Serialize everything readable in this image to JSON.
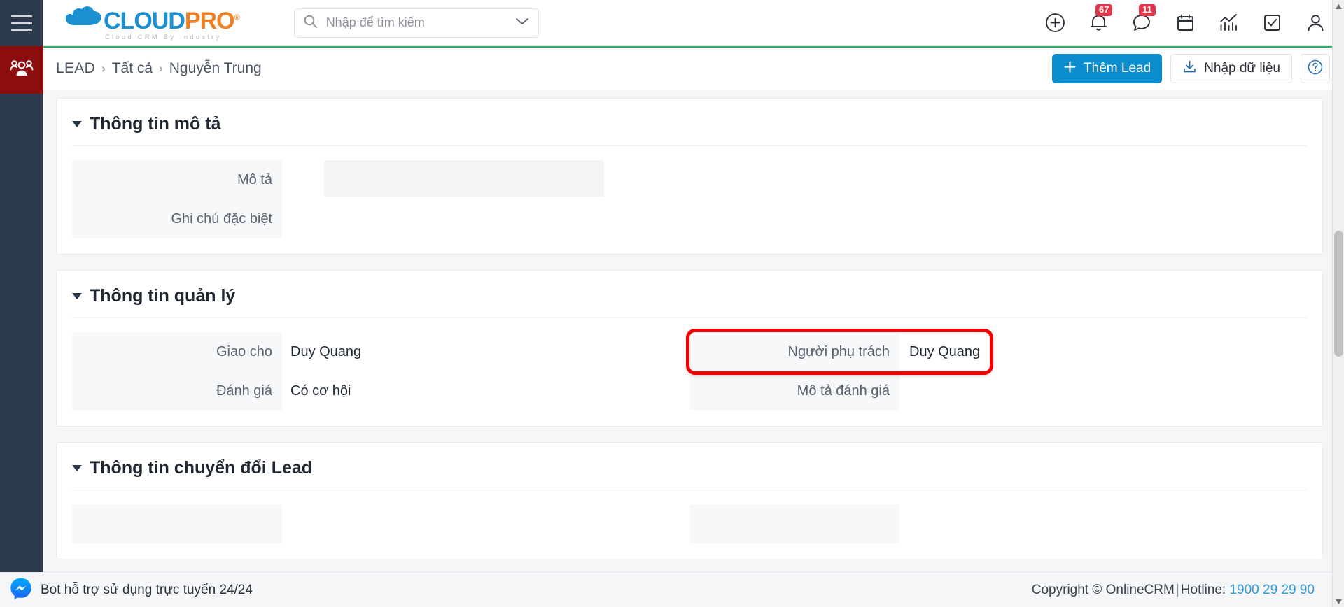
{
  "app": {
    "logo_cloud": "CLOUD",
    "logo_pro": "PRO",
    "logo_reg": "®",
    "logo_tagline": "Cloud CRM By Industry",
    "accent_blue": "#0b8ccd",
    "accent_orange": "#f07f22",
    "accent_green": "#2eab66",
    "sidebar_active_color": "#8c0d0d",
    "highlight_color": "#f40000"
  },
  "sidebar": {
    "menu_icon": "hamburger-icon",
    "items": [
      {
        "icon": "people-group-icon",
        "name": "lead",
        "active": true
      }
    ]
  },
  "search": {
    "placeholder": "Nhập để tìm kiếm",
    "value": "",
    "icon": "search-icon",
    "dropdown_icon": "chevron-down-icon"
  },
  "topbar_icons": [
    {
      "name": "add-circle-icon",
      "badge": ""
    },
    {
      "name": "bell-icon",
      "badge": "67"
    },
    {
      "name": "chat-bubble-icon",
      "badge": "11"
    },
    {
      "name": "calendar-icon",
      "badge": ""
    },
    {
      "name": "chart-icon",
      "badge": ""
    },
    {
      "name": "task-check-icon",
      "badge": ""
    },
    {
      "name": "user-account-icon",
      "badge": ""
    }
  ],
  "breadcrumb": {
    "items": [
      "LEAD",
      "Tất cả",
      "Nguyễn Trung"
    ],
    "separator": "›"
  },
  "header_actions": {
    "add_lead": "Thêm Lead",
    "add_icon": "plus-icon",
    "import": "Nhập dữ liệu",
    "import_icon": "download-icon",
    "help_icon": "question-circle-icon"
  },
  "sections": [
    {
      "title": "Thông tin mô tả",
      "collapse_icon": "caret-down-icon",
      "fields_left": [
        {
          "label": "Mô tả",
          "value": ""
        },
        {
          "label": "Ghi chú đặc biệt",
          "value": ""
        }
      ],
      "fields_right": []
    },
    {
      "title": "Thông tin quản lý",
      "collapse_icon": "caret-down-icon",
      "rows": [
        {
          "left": {
            "label": "Giao cho",
            "value": "Duy Quang"
          },
          "right": {
            "label": "Người phụ trách",
            "value": "Duy Quang",
            "highlighted": true
          }
        },
        {
          "left": {
            "label": "Đánh giá",
            "value": "Có cơ hội"
          },
          "right": {
            "label": "Mô tả đánh giá",
            "value": ""
          }
        }
      ]
    },
    {
      "title": "Thông tin chuyển đổi Lead",
      "collapse_icon": "caret-down-icon",
      "rows": []
    }
  ],
  "footer": {
    "chat_label": "Bot hỗ trợ sử dụng trực tuyến 24/24",
    "chat_icon": "messenger-icon",
    "copyright": "Copyright © OnlineCRM",
    "pipe": "|",
    "hotline_label": "Hotline:",
    "hotline_number": "1900 29 29 90"
  },
  "scrollbar": {
    "up_icon": "triangle-up-icon",
    "down_icon": "triangle-down-icon"
  }
}
